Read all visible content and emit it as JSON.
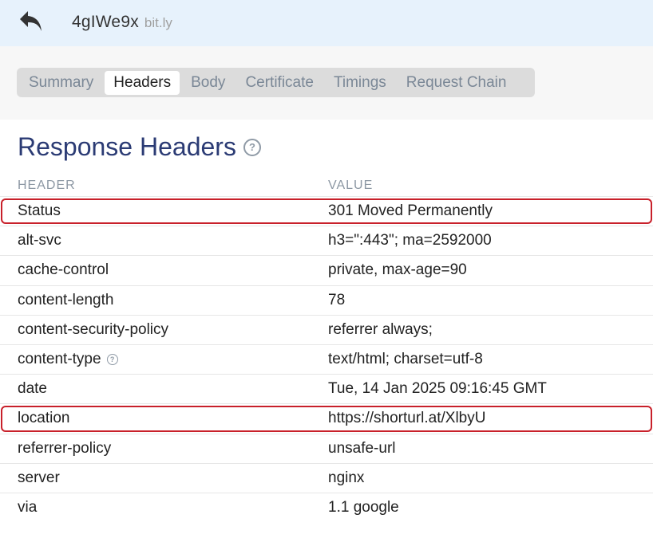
{
  "header": {
    "back_icon": "reply-arrow-icon",
    "title": "4gIWe9x",
    "host": "bit.ly"
  },
  "tabs": [
    {
      "label": "Summary",
      "active": false
    },
    {
      "label": "Headers",
      "active": true
    },
    {
      "label": "Body",
      "active": false
    },
    {
      "label": "Certificate",
      "active": false
    },
    {
      "label": "Timings",
      "active": false
    },
    {
      "label": "Request Chain",
      "active": false
    }
  ],
  "section": {
    "title": "Response Headers",
    "help_icon": "question-circle-icon"
  },
  "table": {
    "columns": {
      "header": "HEADER",
      "value": "VALUE"
    },
    "rows": [
      {
        "name": "Status",
        "value": "301 Moved Permanently",
        "highlighted": true,
        "help": false
      },
      {
        "name": "alt-svc",
        "value": "h3=\":443\"; ma=2592000",
        "highlighted": false,
        "help": false
      },
      {
        "name": "cache-control",
        "value": "private, max-age=90",
        "highlighted": false,
        "help": false
      },
      {
        "name": "content-length",
        "value": "78",
        "highlighted": false,
        "help": false
      },
      {
        "name": "content-security-policy",
        "value": "referrer always;",
        "highlighted": false,
        "help": false
      },
      {
        "name": "content-type",
        "value": "text/html; charset=utf-8",
        "highlighted": false,
        "help": true
      },
      {
        "name": "date",
        "value": "Tue, 14 Jan 2025 09:16:45 GMT",
        "highlighted": false,
        "help": false
      },
      {
        "name": "location",
        "value": "https://shorturl.at/XlbyU",
        "highlighted": true,
        "help": false
      },
      {
        "name": "referrer-policy",
        "value": "unsafe-url",
        "highlighted": false,
        "help": false
      },
      {
        "name": "server",
        "value": "nginx",
        "highlighted": false,
        "help": false
      },
      {
        "name": "via",
        "value": "1.1 google",
        "highlighted": false,
        "help": false
      }
    ]
  },
  "colors": {
    "topbar_bg": "#e7f2fc",
    "title_color": "#2b3b74",
    "highlight_border": "#c8202a"
  }
}
